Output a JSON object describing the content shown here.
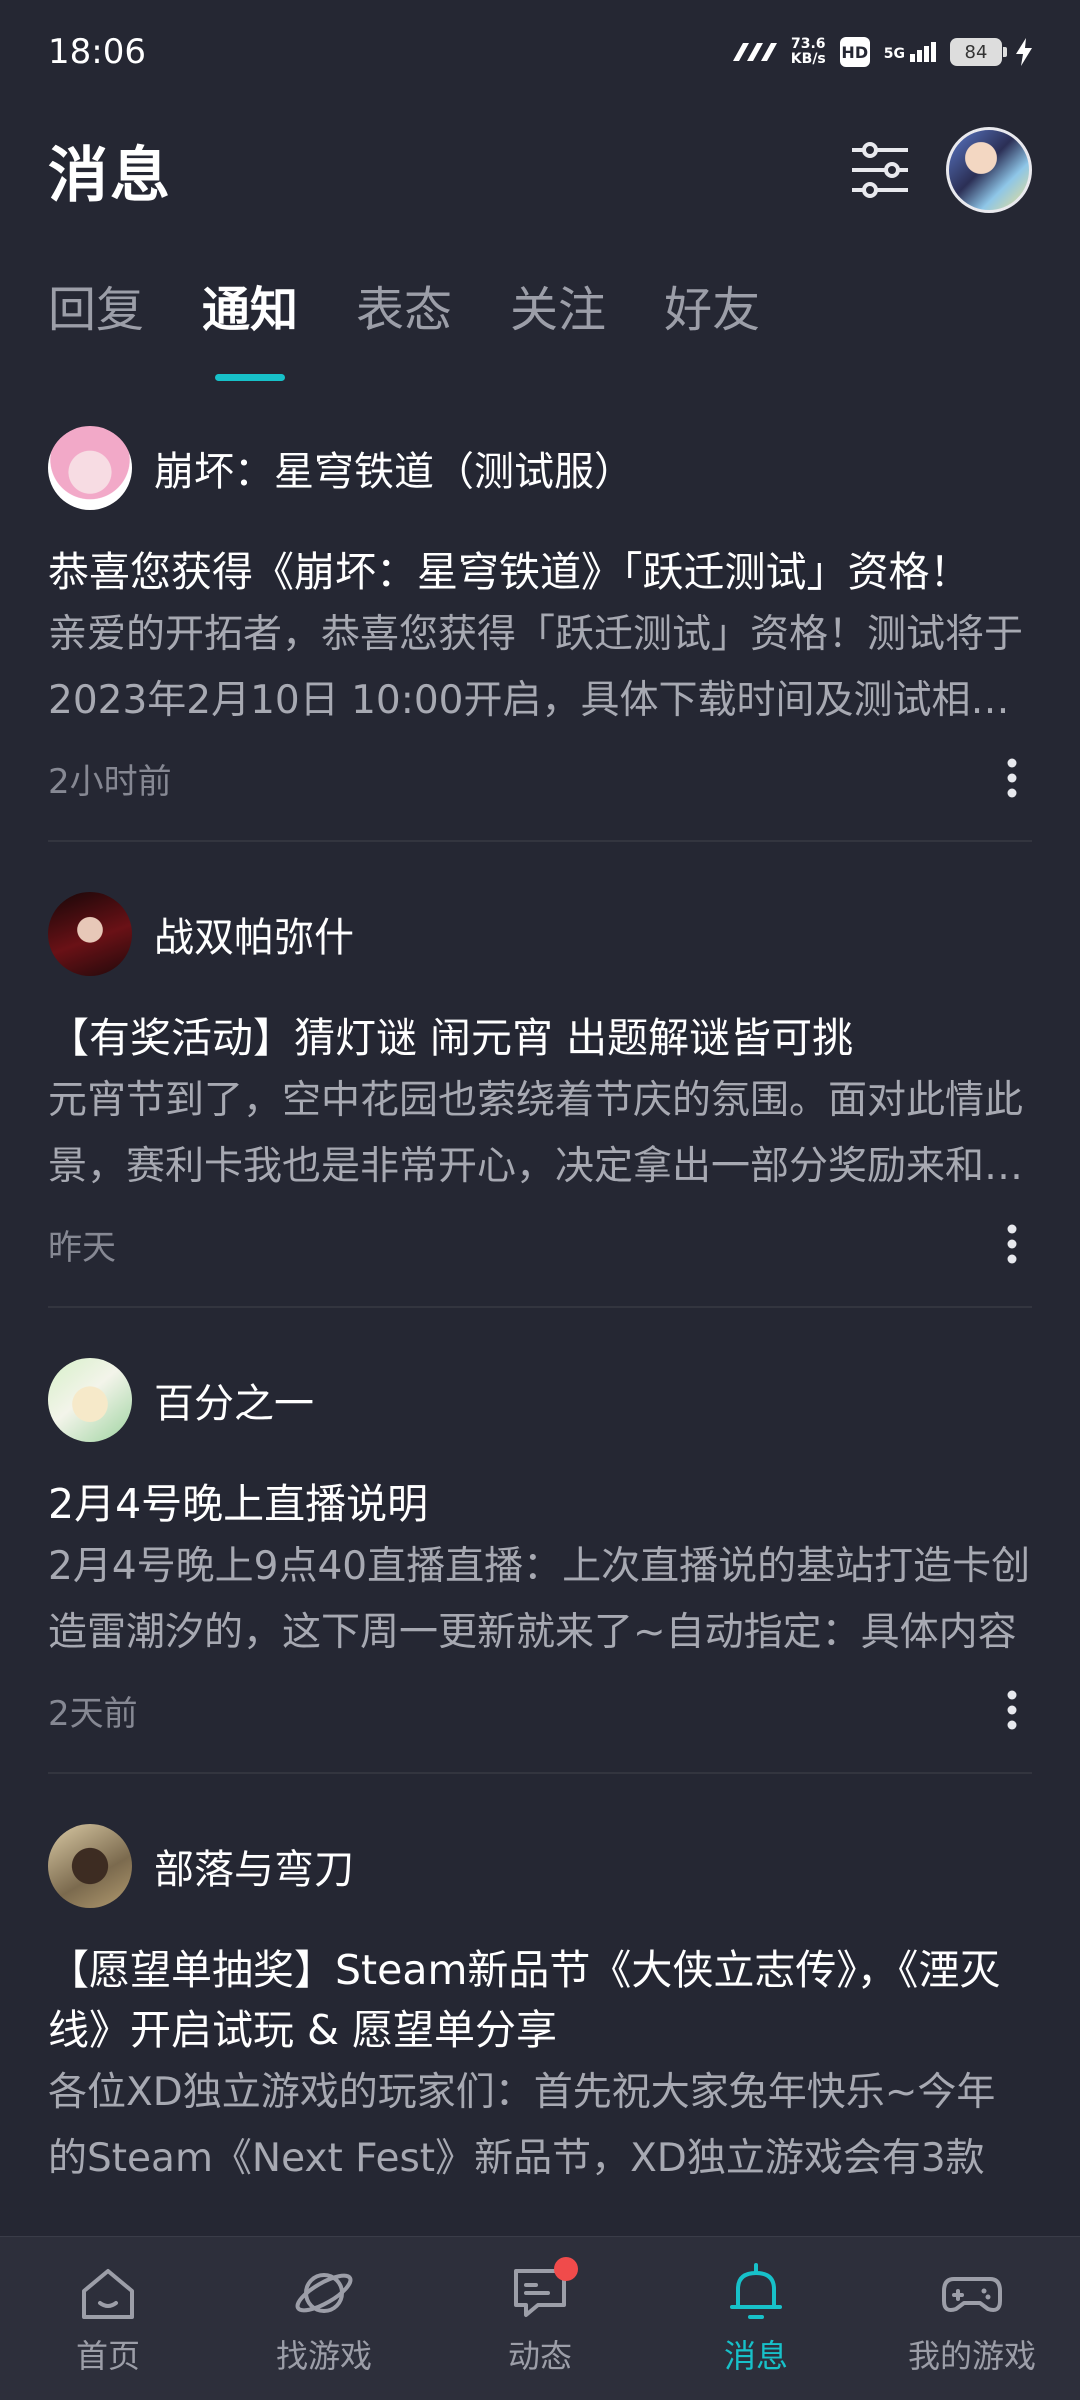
{
  "status_bar": {
    "time": "18:06",
    "net_speed_value": "73.6",
    "net_speed_unit": "KB/s",
    "hd": "HD",
    "network": "5G",
    "battery": "84"
  },
  "header": {
    "title": "消息",
    "filter_icon": "sliders-icon",
    "avatar_icon": "user-avatar"
  },
  "tabs": [
    {
      "label": "回复",
      "active": false
    },
    {
      "label": "通知",
      "active": true
    },
    {
      "label": "表态",
      "active": false
    },
    {
      "label": "关注",
      "active": false
    },
    {
      "label": "好友",
      "active": false
    }
  ],
  "notifications": [
    {
      "sender": "崩坏：星穹铁道（测试服）",
      "title": "恭喜您获得《崩坏：星穹铁道》「跃迁测试」资格！",
      "body": "亲爱的开拓者，恭喜您获得「跃迁测试」资格！测试将于2023年2月10日 10:00开启，具体下载时间及测试相关信息请关注官方公告。",
      "time": "2小时前"
    },
    {
      "sender": "战双帕弥什",
      "title": "【有奖活动】猜灯谜 闹元宵 出题解谜皆可挑",
      "body": "元宵节到了，空中花园也萦绕着节庆的氛围。面对此情此景，赛利卡我也是非常开心，决定拿出一部分奖励来和大家一起庆祝。",
      "time": "昨天"
    },
    {
      "sender": "百分之一",
      "title": "2月4号晚上直播说明",
      "body": "2月4号晚上9点40直播直播：上次直播说的基站打造卡创造雷潮汐的，这下周一更新就来了~自动指定：具体内容",
      "time": "2天前"
    },
    {
      "sender": "部落与弯刀",
      "title": "【愿望单抽奖】Steam新品节《大侠立志传》，《湮灭线》开启试玩 & 愿望单分享",
      "body": "各位XD独立游戏的玩家们：首先祝大家兔年快乐~今年的Steam《Next Fest》新品节，XD独立游戏会有3款",
      "time": ""
    }
  ],
  "bottom_nav": [
    {
      "label": "首页",
      "icon": "home-icon",
      "active": false
    },
    {
      "label": "找游戏",
      "icon": "planet-icon",
      "active": false
    },
    {
      "label": "动态",
      "icon": "chat-icon",
      "active": false
    },
    {
      "label": "消息",
      "icon": "bell-icon",
      "active": true
    },
    {
      "label": "我的游戏",
      "icon": "gamepad-icon",
      "active": false
    }
  ],
  "colors": {
    "background": "#252733",
    "accent": "#17c1c9",
    "badge": "#f04b4b"
  }
}
